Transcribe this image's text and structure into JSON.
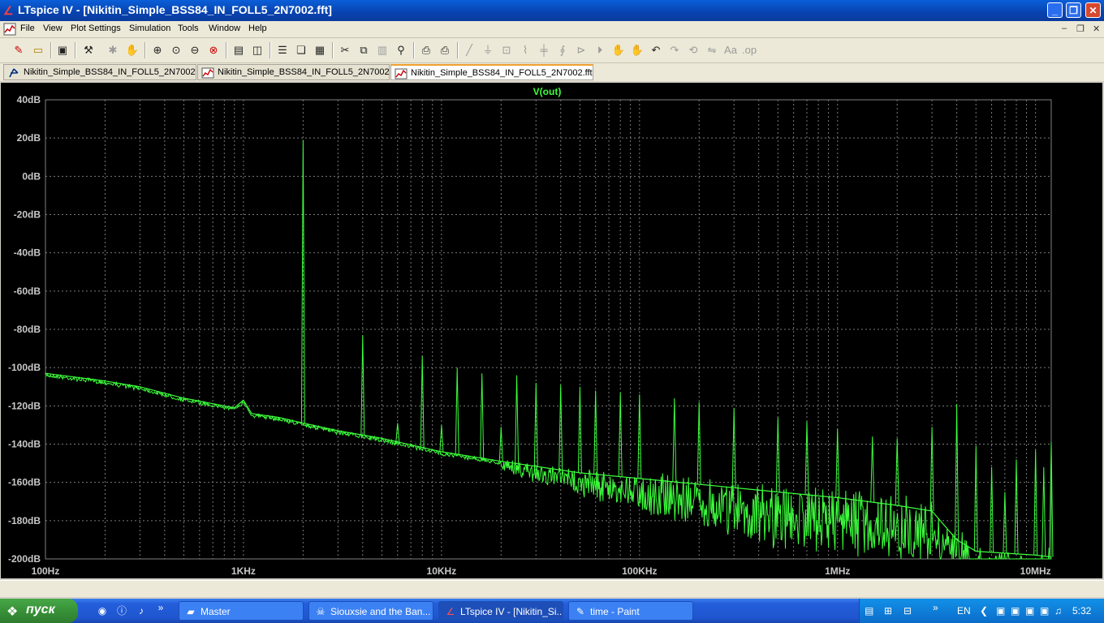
{
  "window": {
    "title": "LTspice IV - [Nikitin_Simple_BSS84_IN_FOLL5_2N7002.fft]"
  },
  "menu": [
    "File",
    "View",
    "Plot Settings",
    "Simulation",
    "Tools",
    "Window",
    "Help"
  ],
  "tabs": [
    {
      "label": "Nikitin_Simple_BSS84_IN_FOLL5_2N7002",
      "icon": "schematic-icon",
      "active": false
    },
    {
      "label": "Nikitin_Simple_BSS84_IN_FOLL5_2N7002",
      "icon": "waveform-icon",
      "active": false
    },
    {
      "label": "Nikitin_Simple_BSS84_IN_FOLL5_2N7002.fft",
      "icon": "waveform-icon",
      "active": true
    }
  ],
  "colors": {
    "plot_bg": "#000000",
    "trace": "#3cff3c",
    "grid": "#7a7a7a",
    "label": "#c8c8c8"
  },
  "chart_data": {
    "type": "line",
    "title": "V(out)",
    "x_scale": "log",
    "x_ticks": [
      "100Hz",
      "1KHz",
      "10KHz",
      "100KHz",
      "1MHz",
      "10MHz"
    ],
    "x_tick_values": [
      100,
      1000,
      10000,
      100000,
      1000000,
      10000000
    ],
    "xlim": [
      100,
      12000000
    ],
    "y_ticks": [
      "40dB",
      "20dB",
      "0dB",
      "-20dB",
      "-40dB",
      "-60dB",
      "-80dB",
      "-100dB",
      "-120dB",
      "-140dB",
      "-160dB",
      "-180dB",
      "-200dB"
    ],
    "y_tick_values": [
      40,
      20,
      0,
      -20,
      -40,
      -60,
      -80,
      -100,
      -120,
      -140,
      -160,
      -180,
      -200
    ],
    "ylim": [
      -200,
      40
    ],
    "grid": true,
    "series": [
      {
        "name": "V(out)",
        "noise_floor": [
          [
            100,
            -103
          ],
          [
            200,
            -107
          ],
          [
            300,
            -110
          ],
          [
            500,
            -116
          ],
          [
            900,
            -121
          ],
          [
            1000,
            -117
          ],
          [
            1100,
            -124
          ],
          [
            1500,
            -126
          ],
          [
            2000,
            -129
          ],
          [
            3000,
            -133
          ],
          [
            5000,
            -137
          ],
          [
            10000,
            -144
          ],
          [
            20000,
            -149
          ],
          [
            50000,
            -155
          ],
          [
            100000,
            -158
          ],
          [
            200000,
            -161
          ],
          [
            500000,
            -165
          ],
          [
            1000000,
            -168
          ],
          [
            2000000,
            -172
          ],
          [
            3000000,
            -175
          ],
          [
            4000000,
            -190
          ],
          [
            5000000,
            -196
          ],
          [
            10000000,
            -198
          ],
          [
            12000000,
            -199
          ]
        ],
        "peaks": [
          [
            2000,
            19
          ],
          [
            4000,
            -83
          ],
          [
            6000,
            -129
          ],
          [
            8000,
            -94
          ],
          [
            10000,
            -130
          ],
          [
            12000,
            -100
          ],
          [
            16000,
            -103
          ],
          [
            20000,
            -131
          ],
          [
            24000,
            -104
          ],
          [
            30000,
            -108
          ],
          [
            40000,
            -109
          ],
          [
            50000,
            -110
          ],
          [
            60000,
            -112
          ],
          [
            80000,
            -113
          ],
          [
            100000,
            -114
          ],
          [
            150000,
            -116
          ],
          [
            200000,
            -118
          ],
          [
            300000,
            -121
          ],
          [
            500000,
            -126
          ],
          [
            700000,
            -128
          ],
          [
            1000000,
            -132
          ],
          [
            1500000,
            -136
          ],
          [
            2000000,
            -137
          ],
          [
            3000000,
            -131
          ],
          [
            4000000,
            -119
          ],
          [
            5000000,
            -141
          ],
          [
            6000000,
            -152
          ],
          [
            7000000,
            -165
          ],
          [
            8000000,
            -148
          ],
          [
            10000000,
            -143
          ],
          [
            11000000,
            -152
          ],
          [
            12000000,
            -139
          ]
        ]
      }
    ]
  },
  "taskbar": {
    "start_label": "пуск",
    "tasks": [
      {
        "label": "Master",
        "icon": "folder-icon",
        "active": false
      },
      {
        "label": "Siouxsie and the Ban...",
        "icon": "alien-icon",
        "active": false
      },
      {
        "label": "LTspice IV - [Nikitin_Si...",
        "icon": "ltspice-icon",
        "active": true
      },
      {
        "label": "time - Paint",
        "icon": "paint-icon",
        "active": false
      }
    ],
    "lang": "EN",
    "clock": "5:32"
  }
}
